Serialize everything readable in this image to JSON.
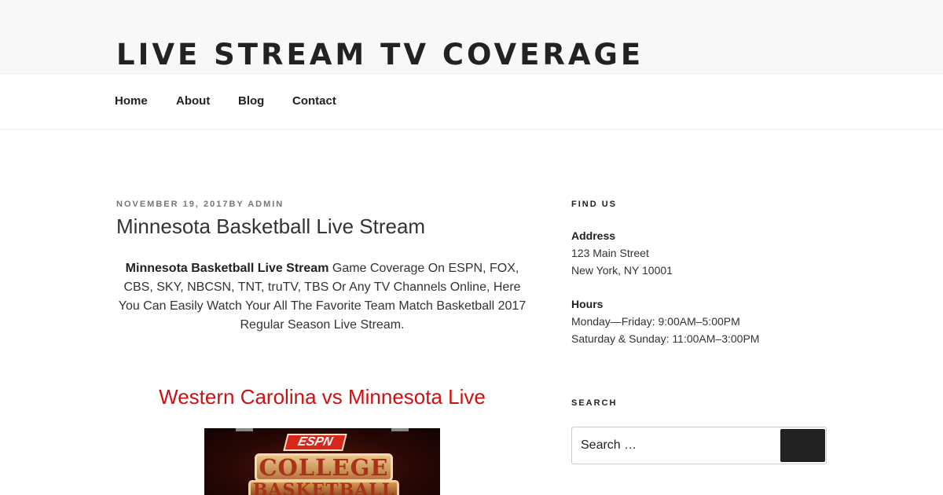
{
  "site": {
    "title": "LIVE STREAM TV COVERAGE"
  },
  "nav": {
    "items": [
      {
        "label": "Home"
      },
      {
        "label": "About"
      },
      {
        "label": "Blog"
      },
      {
        "label": "Contact"
      }
    ]
  },
  "post": {
    "date": "NOVEMBER 19, 2017",
    "by_prefix": "BY",
    "author": "ADMIN",
    "title": "Minnesota Basketball Live Stream",
    "intro_bold": "Minnesota Basketball Live Stream",
    "intro_rest": " Game Coverage On ESPN, FOX, CBS, SKY, NBCSN, TNT, truTV, TBS Or Any TV Channels Online, Here You Can Easily Watch Your All The Favorite Team Match Basketball 2017 Regular Season Live Stream.",
    "subheading": "Western Carolina vs Minnesota Live",
    "image": {
      "logo_text": "ESPN",
      "line1": "COLLEGE",
      "line2": "BASKETBALL"
    }
  },
  "sidebar": {
    "find_us": {
      "title": "FIND US",
      "address_label": "Address",
      "address_line1": "123 Main Street",
      "address_line2": "New York, NY 10001",
      "hours_label": "Hours",
      "hours_line1": "Monday—Friday: 9:00AM–5:00PM",
      "hours_line2": "Saturday & Sunday: 11:00AM–3:00PM"
    },
    "search": {
      "title": "SEARCH",
      "placeholder": "Search …",
      "button_icon": "search-icon"
    }
  },
  "colors": {
    "accent_red": "#cc1111",
    "header_bg": "#f8f8f8",
    "button_bg": "#222222"
  }
}
